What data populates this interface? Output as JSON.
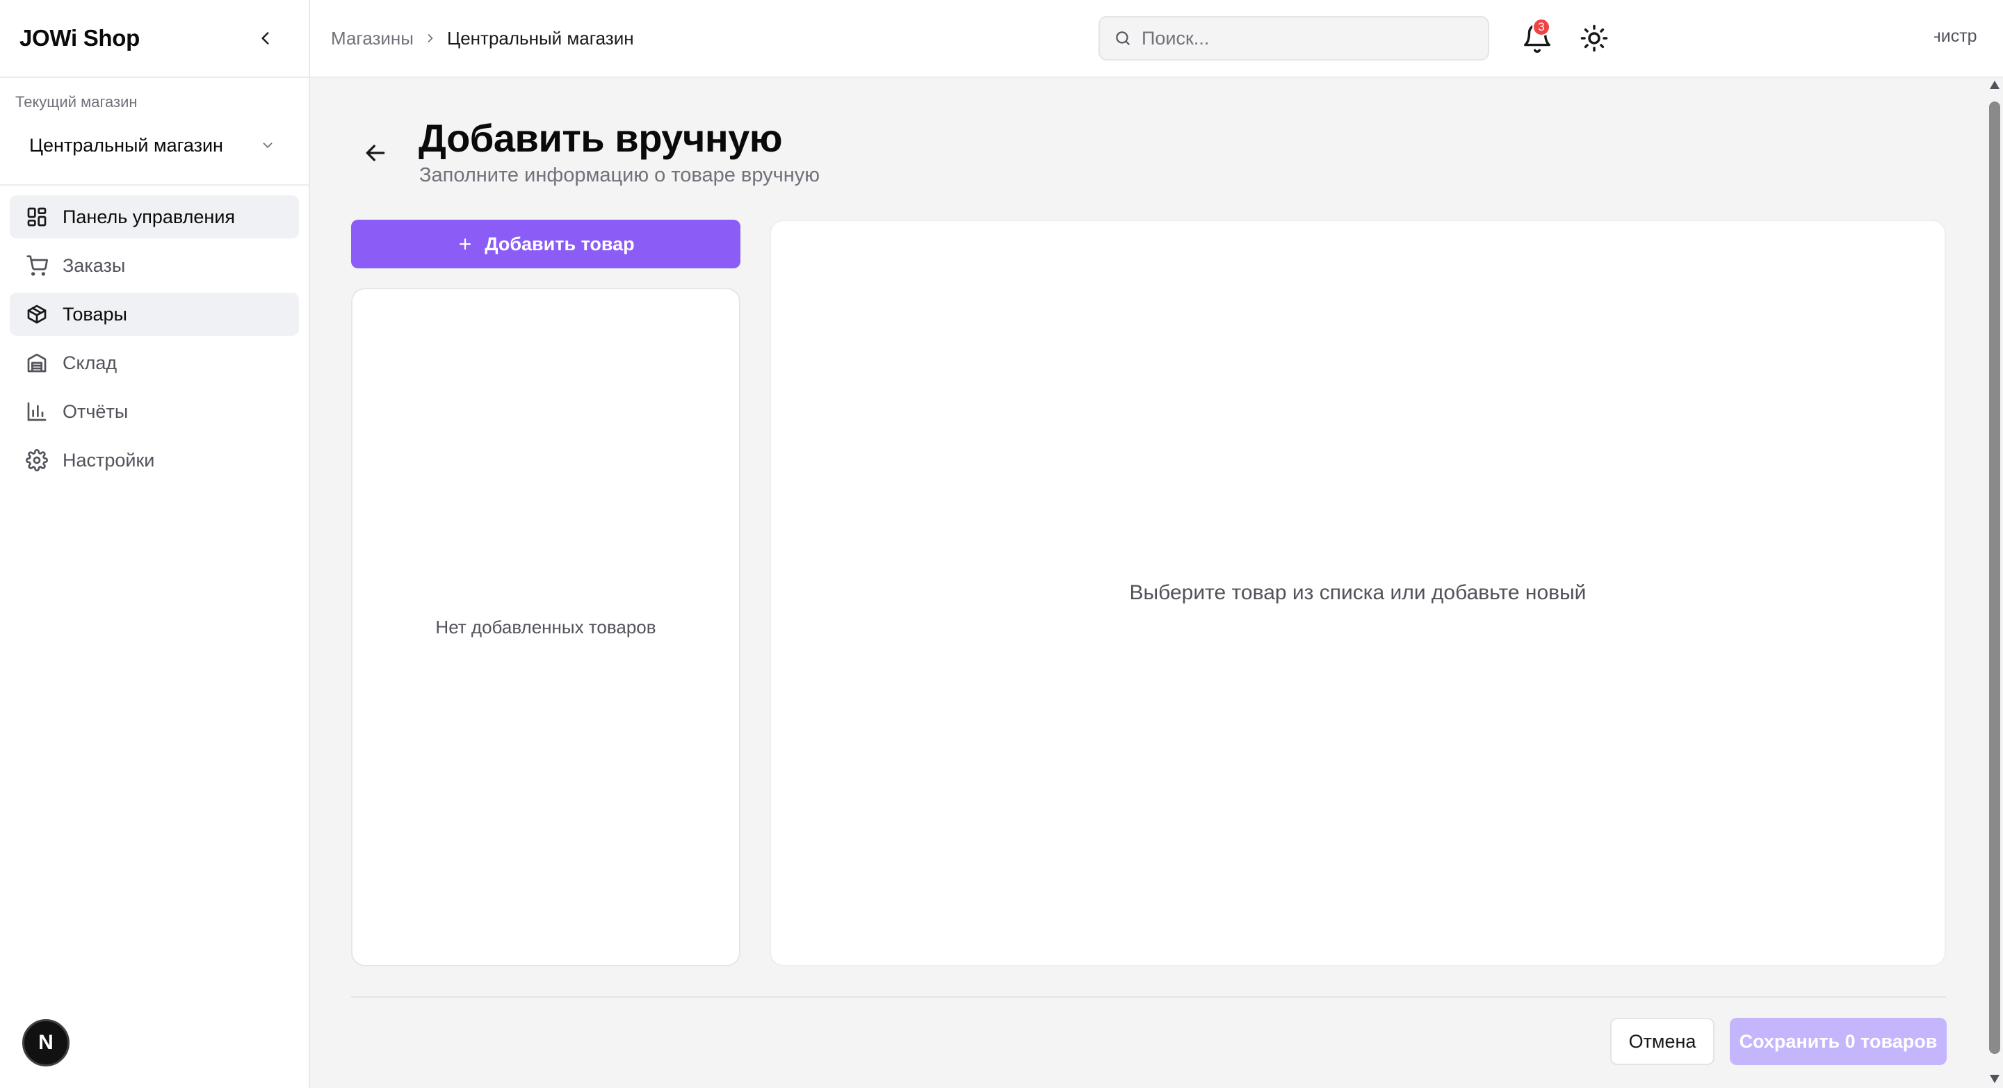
{
  "sidebar": {
    "brand": "JOWi Shop",
    "store_label": "Текущий магазин",
    "store_selected": "Центральный магазин",
    "items": [
      {
        "label": "Панель управления",
        "icon": "dashboard-icon"
      },
      {
        "label": "Заказы",
        "icon": "cart-icon"
      },
      {
        "label": "Товары",
        "icon": "box-icon"
      },
      {
        "label": "Склад",
        "icon": "warehouse-icon"
      },
      {
        "label": "Отчёты",
        "icon": "bar-chart-icon"
      },
      {
        "label": "Настройки",
        "icon": "gear-icon"
      }
    ],
    "avatar_letter": "N"
  },
  "topbar": {
    "breadcrumb": [
      "Магазины",
      "Центральный магазин"
    ],
    "search_placeholder": "Поиск...",
    "notifications_count": "3",
    "user_partial": "инистр"
  },
  "main": {
    "title": "Добавить вручную",
    "subtitle": "Заполните информацию о товаре вручную",
    "add_button": "Добавить товар",
    "list_empty": "Нет добавленных товаров",
    "detail_empty": "Выберите товар из списка или добавьте новый",
    "cancel_button": "Отмена",
    "save_button": "Сохранить 0 товаров"
  },
  "colors": {
    "accent": "#8b5cf6",
    "accent_disabled": "#c4b5fd",
    "badge": "#ef4444"
  }
}
